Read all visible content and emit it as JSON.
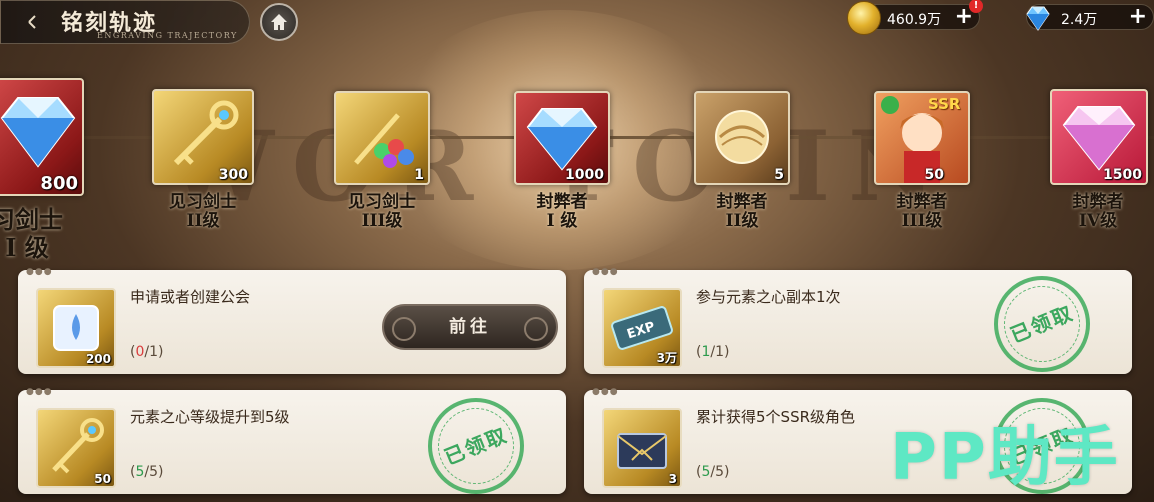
{
  "header": {
    "title": "铭刻轨迹",
    "subtitle": "ENGRAVING TRAJECTORY",
    "back_icon": "crescent-back-icon",
    "home_icon": "home-icon"
  },
  "currencies": [
    {
      "name": "gold",
      "icon": "gold-coin-icon",
      "value": "460.9万",
      "has_alert": true,
      "alert": "!"
    },
    {
      "name": "diamond",
      "icon": "diamond-icon",
      "value": "2.4万",
      "has_alert": false
    }
  ],
  "background_text": "WOR    TO    IN",
  "trajectory": [
    {
      "label_line1": "习剑士",
      "label_line2": "I 级",
      "qty": "800",
      "reward": "diamond",
      "frame": "red",
      "current": true
    },
    {
      "label_line1": "见习剑士",
      "label_line2": "II级",
      "qty": "300",
      "reward": "golden-key",
      "frame": "gold",
      "current": false
    },
    {
      "label_line1": "见习剑士",
      "label_line2": "III级",
      "qty": "1",
      "reward": "gem-key-bundle",
      "frame": "gold",
      "current": false
    },
    {
      "label_line1": "封弊者",
      "label_line2": "I 级",
      "qty": "1000",
      "reward": "diamond",
      "frame": "red",
      "current": false
    },
    {
      "label_line1": "封弊者",
      "label_line2": "II级",
      "qty": "5",
      "reward": "golden-orb",
      "frame": "brown",
      "current": false
    },
    {
      "label_line1": "封弊者",
      "label_line2": "III级",
      "qty": "50",
      "reward": "ssr-hero",
      "frame": "hero",
      "current": false,
      "badge": "SSR"
    },
    {
      "label_line1": "封弊者",
      "label_line2": "IV级",
      "qty": "1500",
      "reward": "pink-diamond",
      "frame": "pink",
      "current": false
    }
  ],
  "tasks": [
    {
      "desc": "申请或者创建公会",
      "progress_cur": "0",
      "progress_total": "1",
      "icon": "crystal-cube-icon",
      "qty": "200",
      "status": "go",
      "button_label": "前往"
    },
    {
      "desc": "参与元素之心副本1次",
      "progress_cur": "1",
      "progress_total": "1",
      "icon": "exp-ticket-icon",
      "qty": "3万",
      "status": "claimed",
      "stamp_label": "已领取"
    },
    {
      "desc": "元素之心等级提升到5级",
      "progress_cur": "5",
      "progress_total": "5",
      "icon": "golden-key-icon",
      "qty": "50",
      "status": "claimed",
      "stamp_label": "已领取"
    },
    {
      "desc": "累计获得5个SSR级角色",
      "progress_cur": "5",
      "progress_total": "5",
      "icon": "envelope-icon",
      "qty": "3",
      "status": "claimed",
      "stamp_label": "已领取"
    }
  ],
  "brand_watermark": "PP助手",
  "colors": {
    "accent_green": "#2c9a4c",
    "progress_red": "#d83c3c",
    "brand": "#5ee8c4"
  }
}
